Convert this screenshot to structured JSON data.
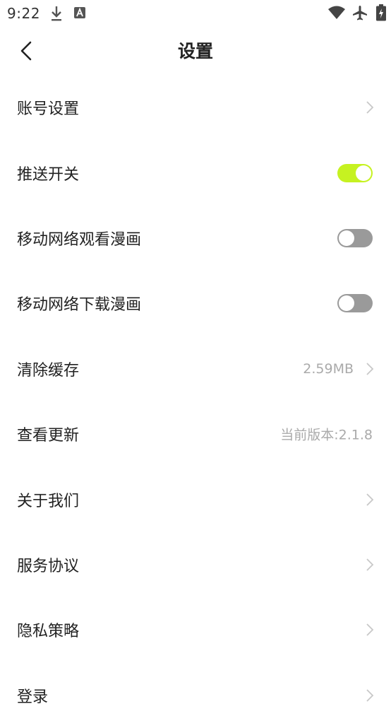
{
  "status_bar": {
    "time": "9:22",
    "icons": [
      "download-icon",
      "a-notification-icon",
      "wifi-icon",
      "airplane-icon",
      "battery-charging-icon"
    ]
  },
  "header": {
    "title": "设置",
    "back_icon": "chevron-left-icon"
  },
  "colors": {
    "toggle_on": "#c6f221",
    "toggle_off": "#9a9a9a",
    "secondary_text": "#aaaaaa"
  },
  "settings": {
    "items": [
      {
        "label": "账号设置",
        "type": "link"
      },
      {
        "label": "推送开关",
        "type": "toggle",
        "on": true
      },
      {
        "label": "移动网络观看漫画",
        "type": "toggle",
        "on": false
      },
      {
        "label": "移动网络下载漫画",
        "type": "toggle",
        "on": false
      },
      {
        "label": "清除缓存",
        "type": "link",
        "value": "2.59MB"
      },
      {
        "label": "查看更新",
        "type": "info",
        "value": "当前版本:2.1.8"
      },
      {
        "label": "关于我们",
        "type": "link"
      },
      {
        "label": "服务协议",
        "type": "link"
      },
      {
        "label": "隐私策略",
        "type": "link"
      },
      {
        "label": "登录",
        "type": "link"
      }
    ]
  }
}
